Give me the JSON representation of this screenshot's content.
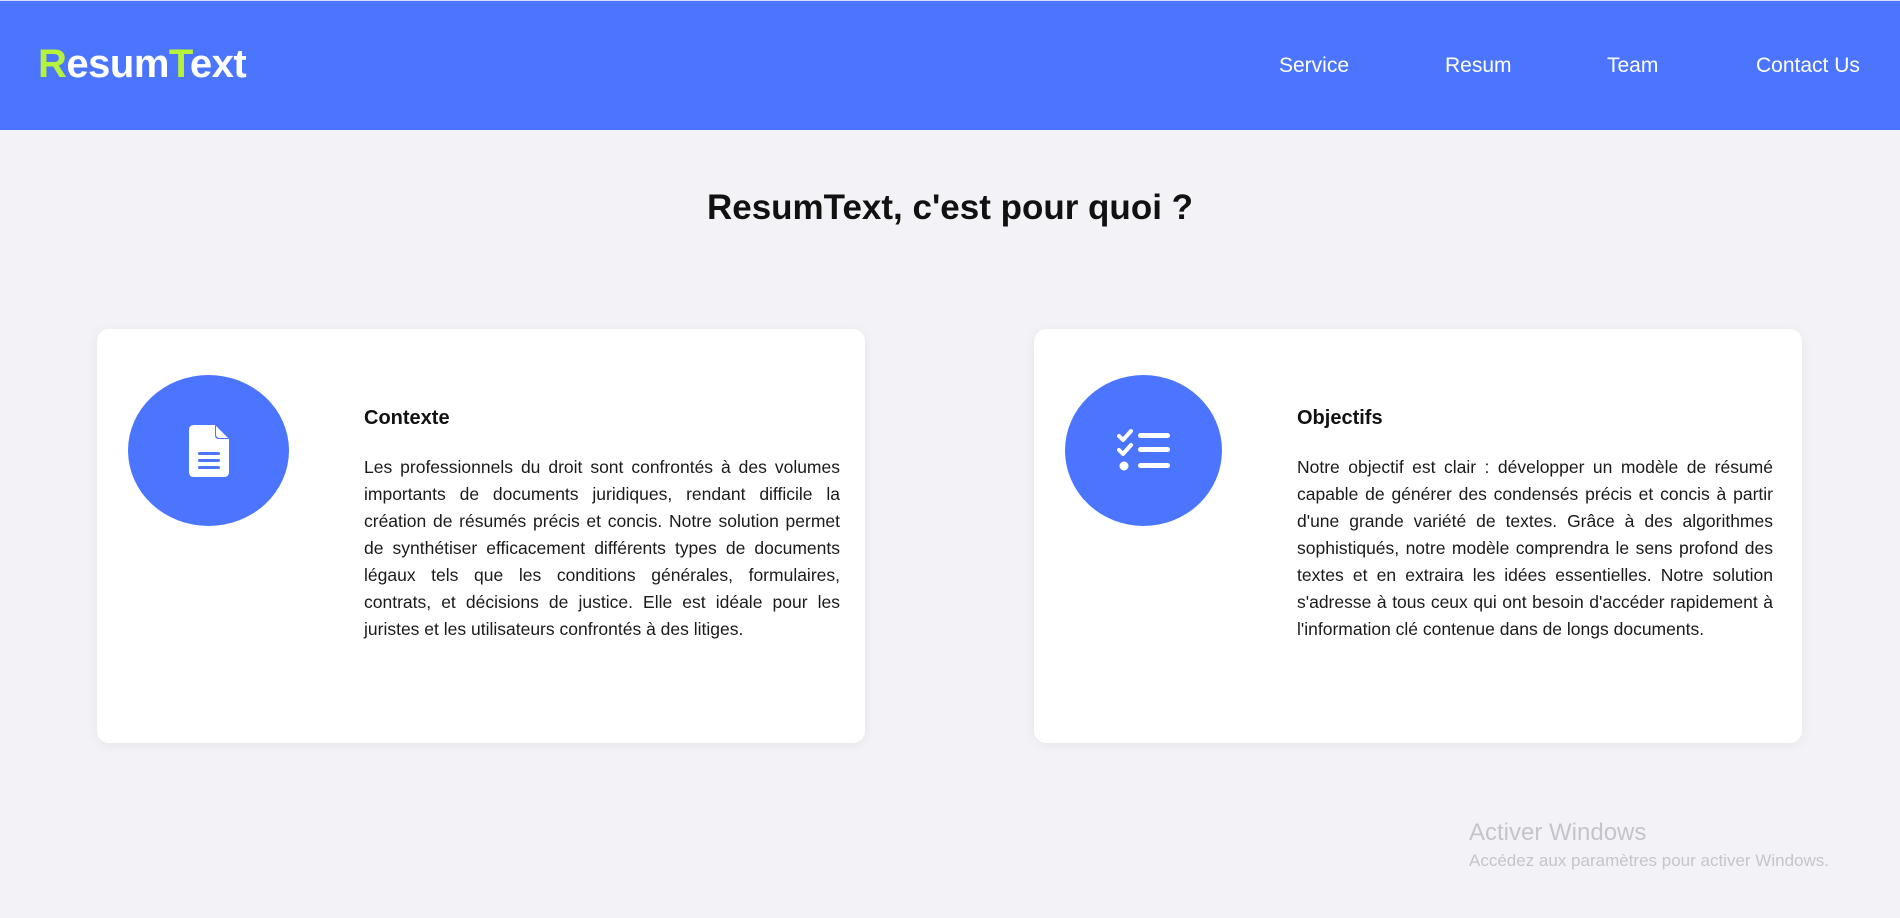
{
  "header": {
    "logo": {
      "part1_accent": "R",
      "part2": "esum",
      "part3_accent": "T",
      "part4": "ext"
    },
    "nav": [
      "Service",
      "Resum",
      "Team",
      "Contact Us"
    ]
  },
  "main": {
    "title": "ResumText, c'est pour quoi ?",
    "cards": [
      {
        "icon": "document-icon",
        "title": "Contexte",
        "text": "Les professionnels du droit sont confrontés à des volumes importants de documents juridiques, rendant difficile la création de résumés précis et concis. Notre solution permet de synthétiser efficacement différents types de documents légaux tels que les conditions générales, formulaires, contrats, et décisions de justice. Elle est idéale pour les juristes et les utilisateurs confrontés à des litiges."
      },
      {
        "icon": "checklist-icon",
        "title": "Objectifs",
        "text": "Notre objectif est clair : développer un modèle de résumé capable de générer des condensés précis et concis à partir d'une grande variété de textes. Grâce à des algorithmes sophistiqués, notre modèle comprendra le sens profond des textes et en extraira les idées essentielles. Notre solution s'adresse à tous ceux qui ont besoin d'accéder rapidement à l'information clé contenue dans de longs documents."
      }
    ]
  },
  "watermark": {
    "title": "Activer Windows",
    "subtitle": "Accédez aux paramètres pour activer Windows."
  },
  "colors": {
    "brand": "#4b75ff",
    "logo_accent": "#b6f23a",
    "background": "#f3f3f7"
  }
}
